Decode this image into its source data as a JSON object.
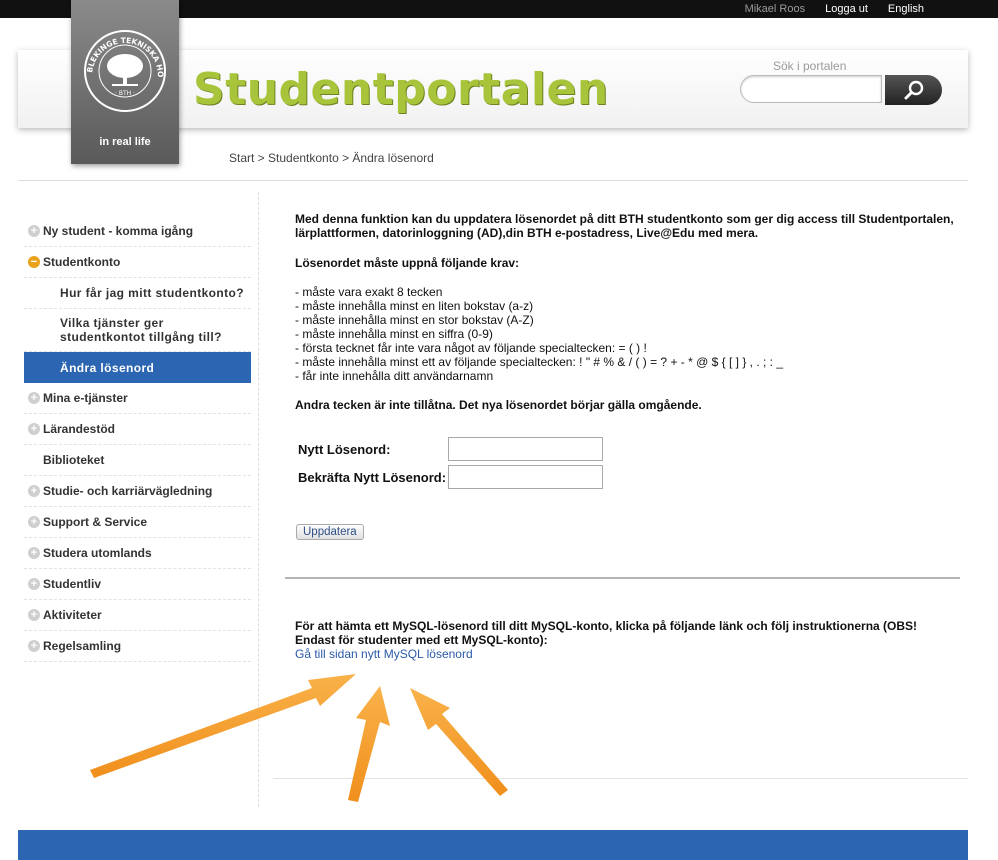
{
  "topbar": {
    "user": "Mikael Roos",
    "logout": "Logga ut",
    "language": "English"
  },
  "logo": {
    "tagline": "in real life",
    "seal_text": "BLEKINGE TEKNISKA HÖGSKOLA · BTH"
  },
  "site_title": "Studentportalen",
  "search": {
    "label": "Sök i portalen",
    "placeholder": ""
  },
  "breadcrumb": "Start > Studentkonto > Ändra lösenord",
  "colors": {
    "accent_blue": "#2c66b2",
    "title_green": "#a8c43a",
    "arrow_orange": "#f5a02e",
    "open_icon": "#e9a21e"
  },
  "sidebar": {
    "items": [
      {
        "label": "Ny student - komma igång",
        "icon": "plus-icon"
      },
      {
        "label": "Studentkonto",
        "icon": "minus-icon"
      },
      {
        "label": "Hur får jag mitt studentkonto?"
      },
      {
        "label": "Vilka tjänster ger studentkontot tillgång till?"
      },
      {
        "label": "Ändra lösenord"
      },
      {
        "label": "Mina e-tjänster",
        "icon": "plus-icon"
      },
      {
        "label": "Lärandestöd",
        "icon": "plus-icon"
      },
      {
        "label": "Biblioteket"
      },
      {
        "label": "Studie- och karriärvägledning",
        "icon": "plus-icon"
      },
      {
        "label": "Support & Service",
        "icon": "plus-icon"
      },
      {
        "label": "Studera utomlands",
        "icon": "plus-icon"
      },
      {
        "label": "Studentliv",
        "icon": "plus-icon"
      },
      {
        "label": "Aktiviteter",
        "icon": "plus-icon"
      },
      {
        "label": "Regelsamling",
        "icon": "plus-icon"
      }
    ]
  },
  "main": {
    "intro": "Med denna funktion kan du uppdatera lösenordet på ditt BTH studentkonto som ger dig access till Studentportalen, lärplattformen, datorinloggning (AD),din BTH e-postadress, Live@Edu med mera.",
    "requirements_heading": "Lösenordet måste uppnå följande krav:",
    "requirements": [
      "- måste vara exakt 8 tecken",
      "- måste innehålla minst en liten bokstav (a-z)",
      "- måste innehålla minst en stor bokstav (A-Z)",
      "- måste innehålla minst en siffra (0-9)",
      "- första tecknet får inte vara något av följande specialtecken: = ( ) !",
      "- måste innehålla minst ett av följande specialtecken: ! \" # % & / ( ) = ? + - * @ $ { [ ] } , . ; : _",
      "- får inte innehålla ditt användarnamn"
    ],
    "note": "Andra tecken är inte tillåtna. Det nya lösenordet börjar gälla omgående.",
    "form": {
      "new_password_label": "Nytt Lösenord:",
      "confirm_password_label": "Bekräfta Nytt Lösenord:",
      "new_password_value": "",
      "confirm_password_value": "",
      "submit_label": "Uppdatera"
    },
    "mysql_text": "För att hämta ett MySQL-lösenord till ditt MySQL-konto, klicka på följande länk och följ instruktionerna (OBS! Endast för studenter med ett MySQL-konto):",
    "mysql_link": "Gå till sidan nytt MySQL lösenord"
  }
}
